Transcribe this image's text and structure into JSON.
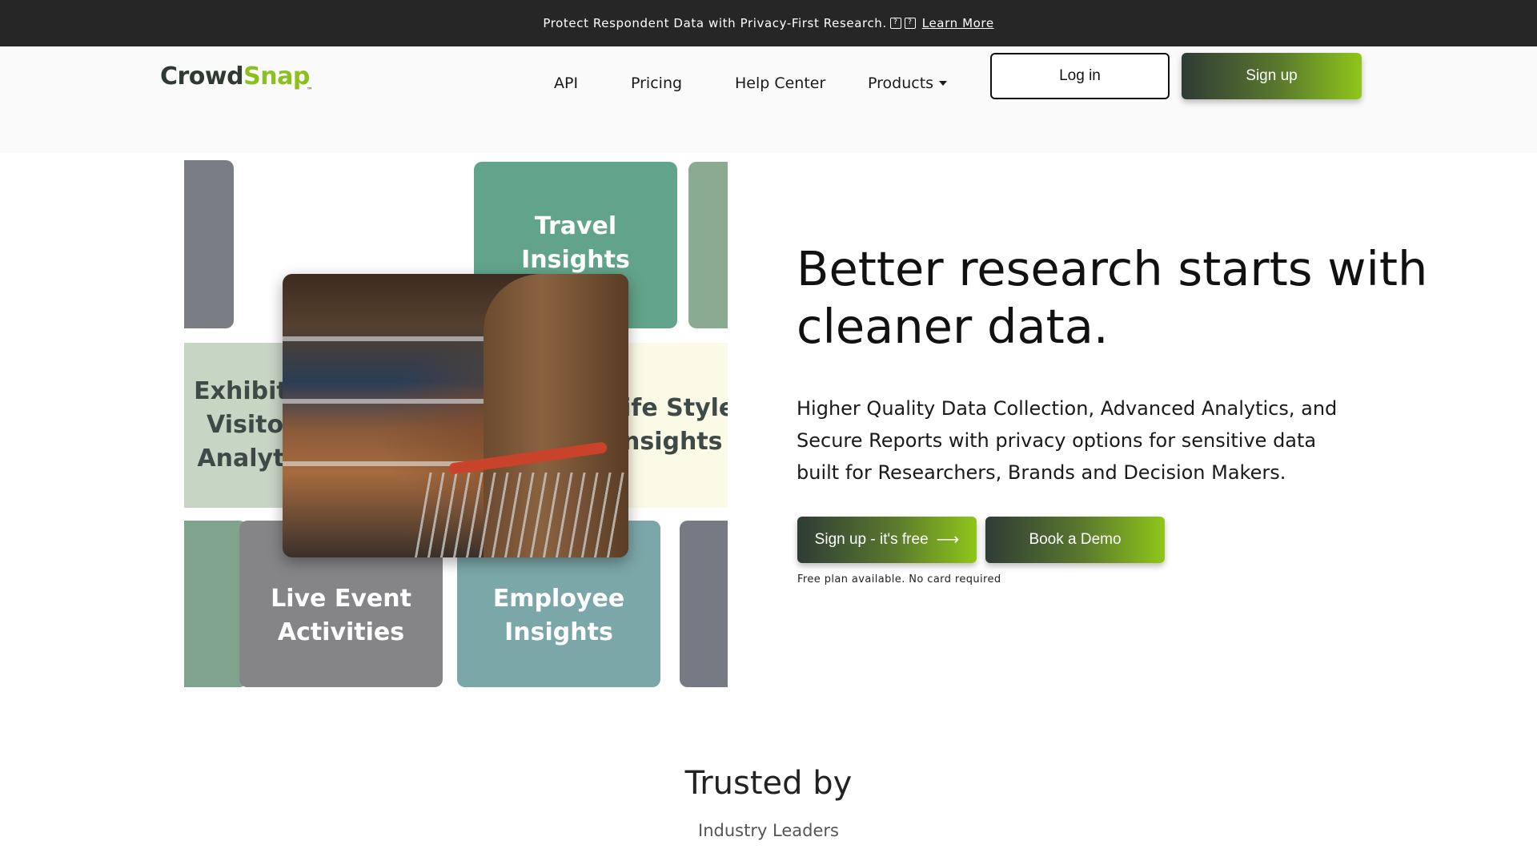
{
  "announcement": {
    "text": "Protect Respondent Data with Privacy-First Research.",
    "glyph_1": "?",
    "glyph_2": "?",
    "link_label": "Learn More"
  },
  "brand": {
    "part_1": "Crowd",
    "part_2": "Snap",
    "tm": "™",
    "color_dark": "#2f3a32",
    "color_accent": "#8cc01f"
  },
  "nav": {
    "api": "API",
    "pricing": "Pricing",
    "help_center": "Help Center",
    "products": "Products"
  },
  "header_buttons": {
    "login": "Log in",
    "signup": "Sign up"
  },
  "collage": {
    "travel": [
      "Travel",
      "Insights"
    ],
    "exhibition": [
      "Exhibiti",
      "Visito",
      "Analyti"
    ],
    "lifestyle": [
      "ife Style",
      "nsights"
    ],
    "live_event": [
      "Live Event",
      "Activities"
    ],
    "employee": [
      "Employee",
      "Insights"
    ]
  },
  "hero": {
    "title_line_1": "Better research starts with",
    "title_line_2": "cleaner data.",
    "subtitle_line_1": "Higher Quality Data Collection, Advanced Analytics, and",
    "subtitle_line_2": "Secure Reports with privacy options for sensitive data",
    "subtitle_line_3": "built for Researchers, Brands and Decision Makers.",
    "cta_primary": "Sign up - it's free",
    "cta_primary_arrow": "⟶",
    "cta_secondary": "Book a Demo",
    "fineprint": "Free plan available. No card required"
  },
  "trusted": {
    "title": "Trusted by",
    "subtitle": "Industry Leaders"
  },
  "colors": {
    "announcement_bg": "#262626",
    "gradient_start": "#2f3b36",
    "gradient_end": "#8fc61a"
  }
}
